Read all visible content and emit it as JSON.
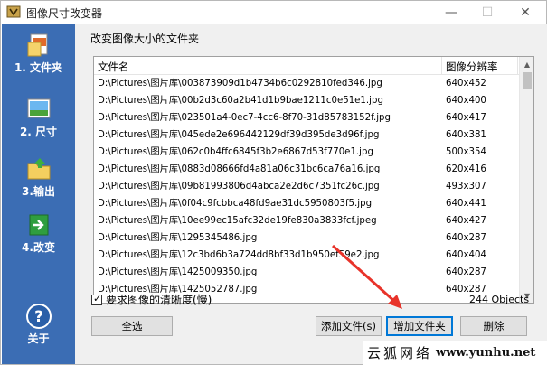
{
  "window": {
    "title": "图像尺寸改变器",
    "minimize_glyph": "—",
    "maximize_glyph": "☐",
    "close_glyph": "✕"
  },
  "sidebar": {
    "background": "#3b6db4",
    "items": [
      {
        "label": "1. 文件夹",
        "icon": "folder-files-icon"
      },
      {
        "label": "2. 尺寸",
        "icon": "image-resize-icon"
      },
      {
        "label": "3.输出",
        "icon": "output-folder-icon"
      },
      {
        "label": "4.改变",
        "icon": "apply-arrow-icon"
      }
    ],
    "about": {
      "label": "关于",
      "icon": "help-question-icon"
    }
  },
  "main": {
    "group_title": "改变图像大小的文件夹",
    "columns": [
      "文件名",
      "图像分辨率"
    ],
    "rows": [
      {
        "name": "D:\\Pictures\\图片库\\003873909d1b4734b6c0292810fed346.jpg",
        "res": "640x452"
      },
      {
        "name": "D:\\Pictures\\图片库\\00b2d3c60a2b41d1b9bae1211c0e51e1.jpg",
        "res": "640x400"
      },
      {
        "name": "D:\\Pictures\\图片库\\023501a4-0ec7-4cc6-8f70-31d85783152f.jpg",
        "res": "640x417"
      },
      {
        "name": "D:\\Pictures\\图片库\\045ede2e696442129df39d395de3d96f.jpg",
        "res": "640x381"
      },
      {
        "name": "D:\\Pictures\\图片库\\062c0b4ffc6845f3b2e6867d53f770e1.jpg",
        "res": "500x354"
      },
      {
        "name": "D:\\Pictures\\图片库\\0883d08666fd4a81a06c31bc6ca76a16.jpg",
        "res": "620x416"
      },
      {
        "name": "D:\\Pictures\\图片库\\09b81993806d4abca2e2d6c7351fc26c.jpg",
        "res": "493x307"
      },
      {
        "name": "D:\\Pictures\\图片库\\0f04c9fcbbca48fd9ae31dc5950803f5.jpg",
        "res": "640x441"
      },
      {
        "name": "D:\\Pictures\\图片库\\10ee99ec15afc32de19fe830a3833fcf.jpeg",
        "res": "640x427"
      },
      {
        "name": "D:\\Pictures\\图片库\\1295345486.jpg",
        "res": "640x287"
      },
      {
        "name": "D:\\Pictures\\图片库\\12c3bd6b3a724dd8bf33d1b950ef59e2.jpg",
        "res": "640x404"
      },
      {
        "name": "D:\\Pictures\\图片库\\1425009350.jpg",
        "res": "640x287"
      },
      {
        "name": "D:\\Pictures\\图片库\\1425052787.jpg",
        "res": "640x287"
      }
    ],
    "require_sharpness_label": "要求图像的清晰度(慢)",
    "require_sharpness_checked": true,
    "count_text": "244 Objects",
    "buttons": {
      "select_all": "全选",
      "add_file": "添加文件(s)",
      "add_folder": "增加文件夹",
      "delete": "删除"
    }
  },
  "annotation": {
    "arrow_color": "#e8332a"
  },
  "watermark": {
    "chinese": "云狐网络",
    "url": "www.yunhu.net"
  }
}
